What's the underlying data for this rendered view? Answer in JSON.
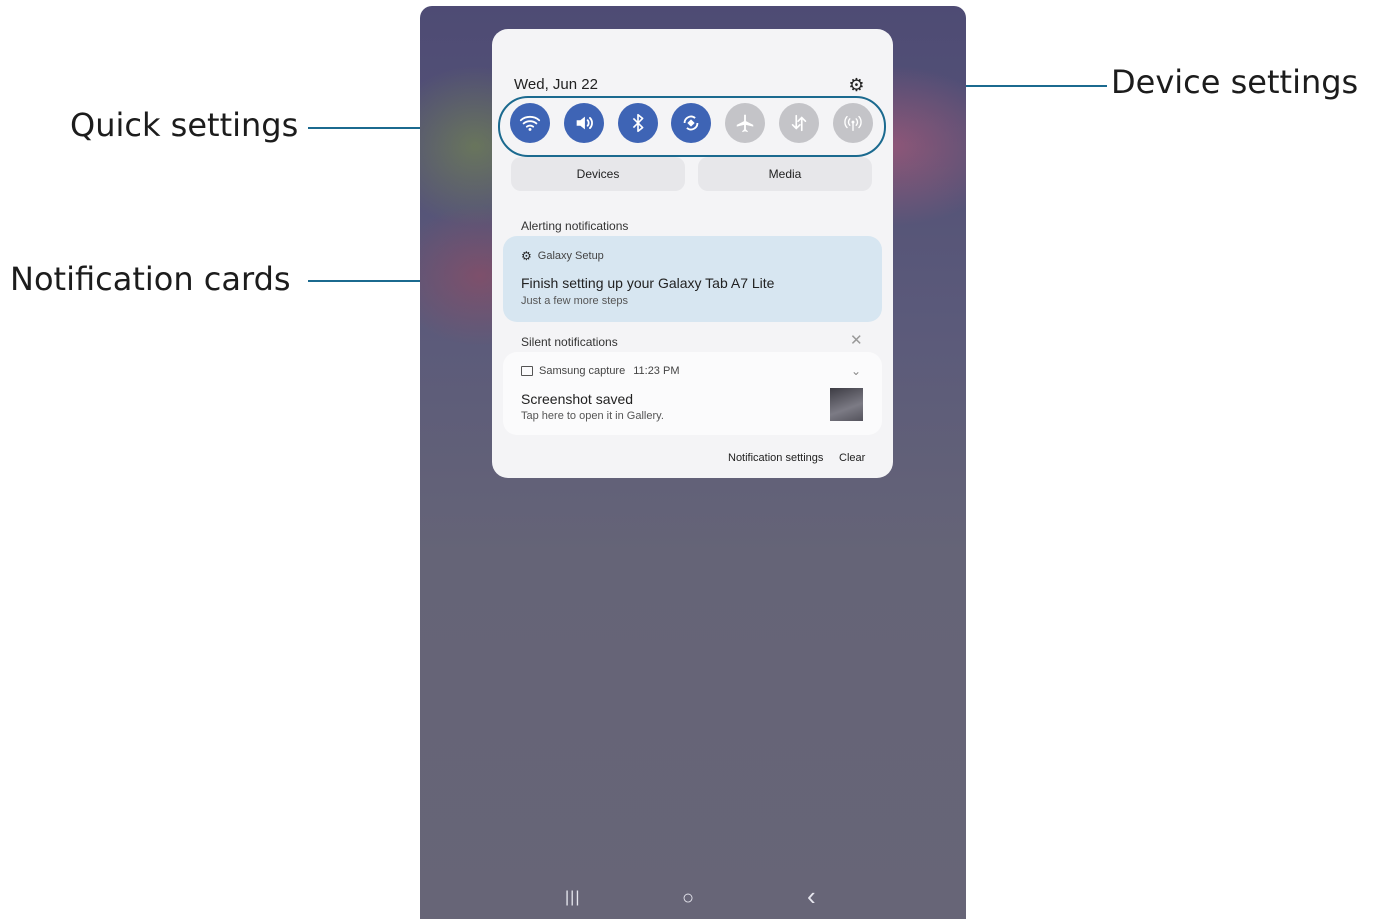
{
  "callouts": {
    "quick_settings": "Quick settings",
    "notification_cards": "Notification cards",
    "device_settings": "Device settings"
  },
  "panel": {
    "date": "Wed, Jun 22",
    "settings_icon": "gear-icon",
    "quick_settings": [
      {
        "icon": "wifi-icon",
        "state": "on"
      },
      {
        "icon": "sound-icon",
        "state": "on"
      },
      {
        "icon": "bluetooth-icon",
        "state": "on"
      },
      {
        "icon": "auto-rotate-icon",
        "state": "on"
      },
      {
        "icon": "airplane-mode-icon",
        "state": "off"
      },
      {
        "icon": "mobile-data-icon",
        "state": "off"
      },
      {
        "icon": "hotspot-icon",
        "state": "off"
      }
    ],
    "devices_label": "Devices",
    "media_label": "Media",
    "alerting_label": "Alerting notifications",
    "alerting_card": {
      "app": "Galaxy Setup",
      "title": "Finish setting up your Galaxy Tab A7 Lite",
      "subtitle": "Just a few more steps"
    },
    "silent_label": "Silent notifications",
    "silent_card": {
      "app": "Samsung capture",
      "time": "11:23 PM",
      "title": "Screenshot saved",
      "subtitle": "Tap here to open it in Gallery."
    },
    "notification_settings_label": "Notification settings",
    "clear_label": "Clear"
  },
  "colors": {
    "accent": "#3e64b5",
    "callout_line": "#1b6a8f"
  },
  "navbar": {
    "recents": "|||",
    "home": "○",
    "back": "‹"
  }
}
